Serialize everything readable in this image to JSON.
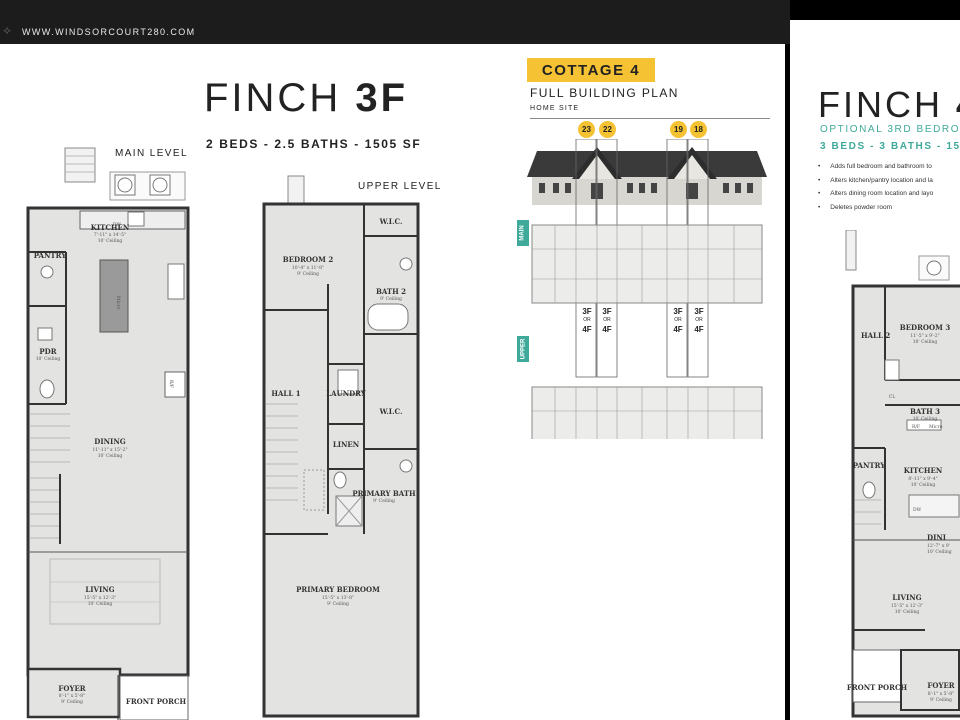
{
  "header": {
    "logo_icon": "star-outline-icon",
    "url": "WWW.WINDSORCOURT280.COM"
  },
  "finch3f": {
    "title_light": "FINCH ",
    "title_bold": "3F",
    "specs": "2 BEDS - 2.5 BATHS - 1505 SF",
    "main_level": "MAIN LEVEL",
    "upper_level": "UPPER LEVEL",
    "main_rooms": {
      "kitchen": "KITCHEN",
      "kitchen_dim": "7'-11\" x 14'-5\"",
      "kitchen_ceil": "10' Ceiling",
      "dw": "DW",
      "pantry": "PANTRY",
      "pdr": "PDR",
      "pdr_ceil": "10' Ceiling",
      "micro": "Micro",
      "rf": "R/F",
      "dining": "DINING",
      "dining_dim": "11'-11\" x 15'-2\"",
      "dining_ceil": "10' Ceiling",
      "living": "LIVING",
      "living_dim": "15'-5\" x 12'-3\"",
      "living_ceil": "10' Ceiling",
      "foyer": "FOYER",
      "foyer_dim": "8'-1\" x 5'-8\"",
      "foyer_ceil": "9' Ceiling",
      "front_porch": "FRONT PORCH"
    },
    "upper_rooms": {
      "bedroom2": "BEDROOM 2",
      "bedroom2_dim": "10'-4\" x 11'-8\"",
      "bedroom2_ceil": "9' Ceiling",
      "wic1": "W.I.C.",
      "bath2": "BATH 2",
      "bath2_ceil": "9' Ceiling",
      "hall": "HALL 1",
      "laundry": "LAUNDRY",
      "wic2": "W.I.C.",
      "linen": "LINEN",
      "primary_bath": "PRIMARY BATH",
      "primary_bath_ceil": "9' Ceiling",
      "primary_bedroom": "PRIMARY BEDROOM",
      "primary_bedroom_dim": "15'-5\" x 13'-8\"",
      "primary_bedroom_ceil": "9' Ceiling"
    }
  },
  "cottage": {
    "badge": "COTTAGE 4",
    "subtitle": "FULL BUILDING PLAN",
    "home_site": "HOME SITE",
    "lots": [
      "23",
      "22",
      "19",
      "18"
    ],
    "main_tab": "MAIN",
    "upper_tab": "UPPER",
    "unit_top": "3F",
    "unit_or": "OR",
    "unit_bottom": "4F"
  },
  "finch4": {
    "title_light": "FINCH ",
    "title_bold": "4",
    "optional": "OPTIONAL 3RD BEDRO",
    "specs": "3 BEDS - 3 BATHS - 150",
    "bullets": [
      "Adds full bedroom and bathroom to",
      "Alters kitchen/pantry location and la",
      "Alters dining room location and layo",
      "Deletes powder room"
    ],
    "rooms": {
      "hall2": "HALL 2",
      "bedroom3": "BEDROOM 3",
      "bedroom3_dim": "11'-5\" x 9'-2\"",
      "bedroom3_ceil": "10' Ceiling",
      "cl": "CL",
      "bath3": "BATH 3",
      "bath3_ceil": "10' Ceiling",
      "rf": "R/F",
      "micro": "Micro",
      "pantry": "PANTRY",
      "kitchen": "KITCHEN",
      "kitchen_dim": "8'-11\" x 9'-4\"",
      "kitchen_ceil": "10' Ceiling",
      "dw": "DW",
      "dining": "DINI",
      "dining_dim": "12'-7\" x 9'",
      "dining_ceil": "10' Ceiling",
      "living": "LIVING",
      "living_dim": "15'-5\" x 12'-3\"",
      "living_ceil": "10' Ceiling",
      "front_porch": "FRONT PORCH",
      "foyer": "FOYER",
      "foyer_dim": "8'-1\" x 5'-8\"",
      "foyer_ceil": "9' Ceiling"
    }
  }
}
